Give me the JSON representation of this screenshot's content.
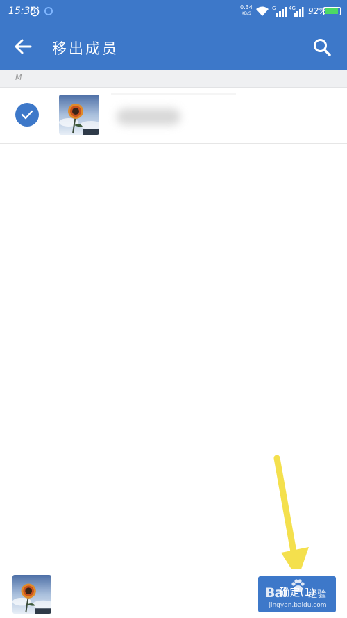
{
  "status_bar": {
    "time": "15:38",
    "net_speed_value": "0.34",
    "net_speed_unit": "KB/S",
    "signal_1_tag": "G",
    "signal_2_tag": "4G",
    "battery_percent": "92%",
    "battery_level": 0.92,
    "icons": [
      "alarm-icon",
      "sync-circle-icon",
      "wifi-icon",
      "signal-icon",
      "battery-icon"
    ]
  },
  "app_bar": {
    "title": "移出成员",
    "back_icon": "arrow-left-icon",
    "search_icon": "search-icon",
    "background": "#3d78c9"
  },
  "member_list": {
    "sections": [
      {
        "letter": "M",
        "members": [
          {
            "selected": true,
            "name_blurred": true,
            "avatar": "sunflower-photo"
          }
        ]
      }
    ]
  },
  "bottom_bar": {
    "selected_avatar": "sunflower-photo",
    "confirm_label": "确定(1)"
  },
  "annotation": {
    "arrow_color": "#f7e04a"
  },
  "watermark": {
    "brand": "Bai",
    "suffix": "经验",
    "url": "jingyan.baidu.com"
  }
}
